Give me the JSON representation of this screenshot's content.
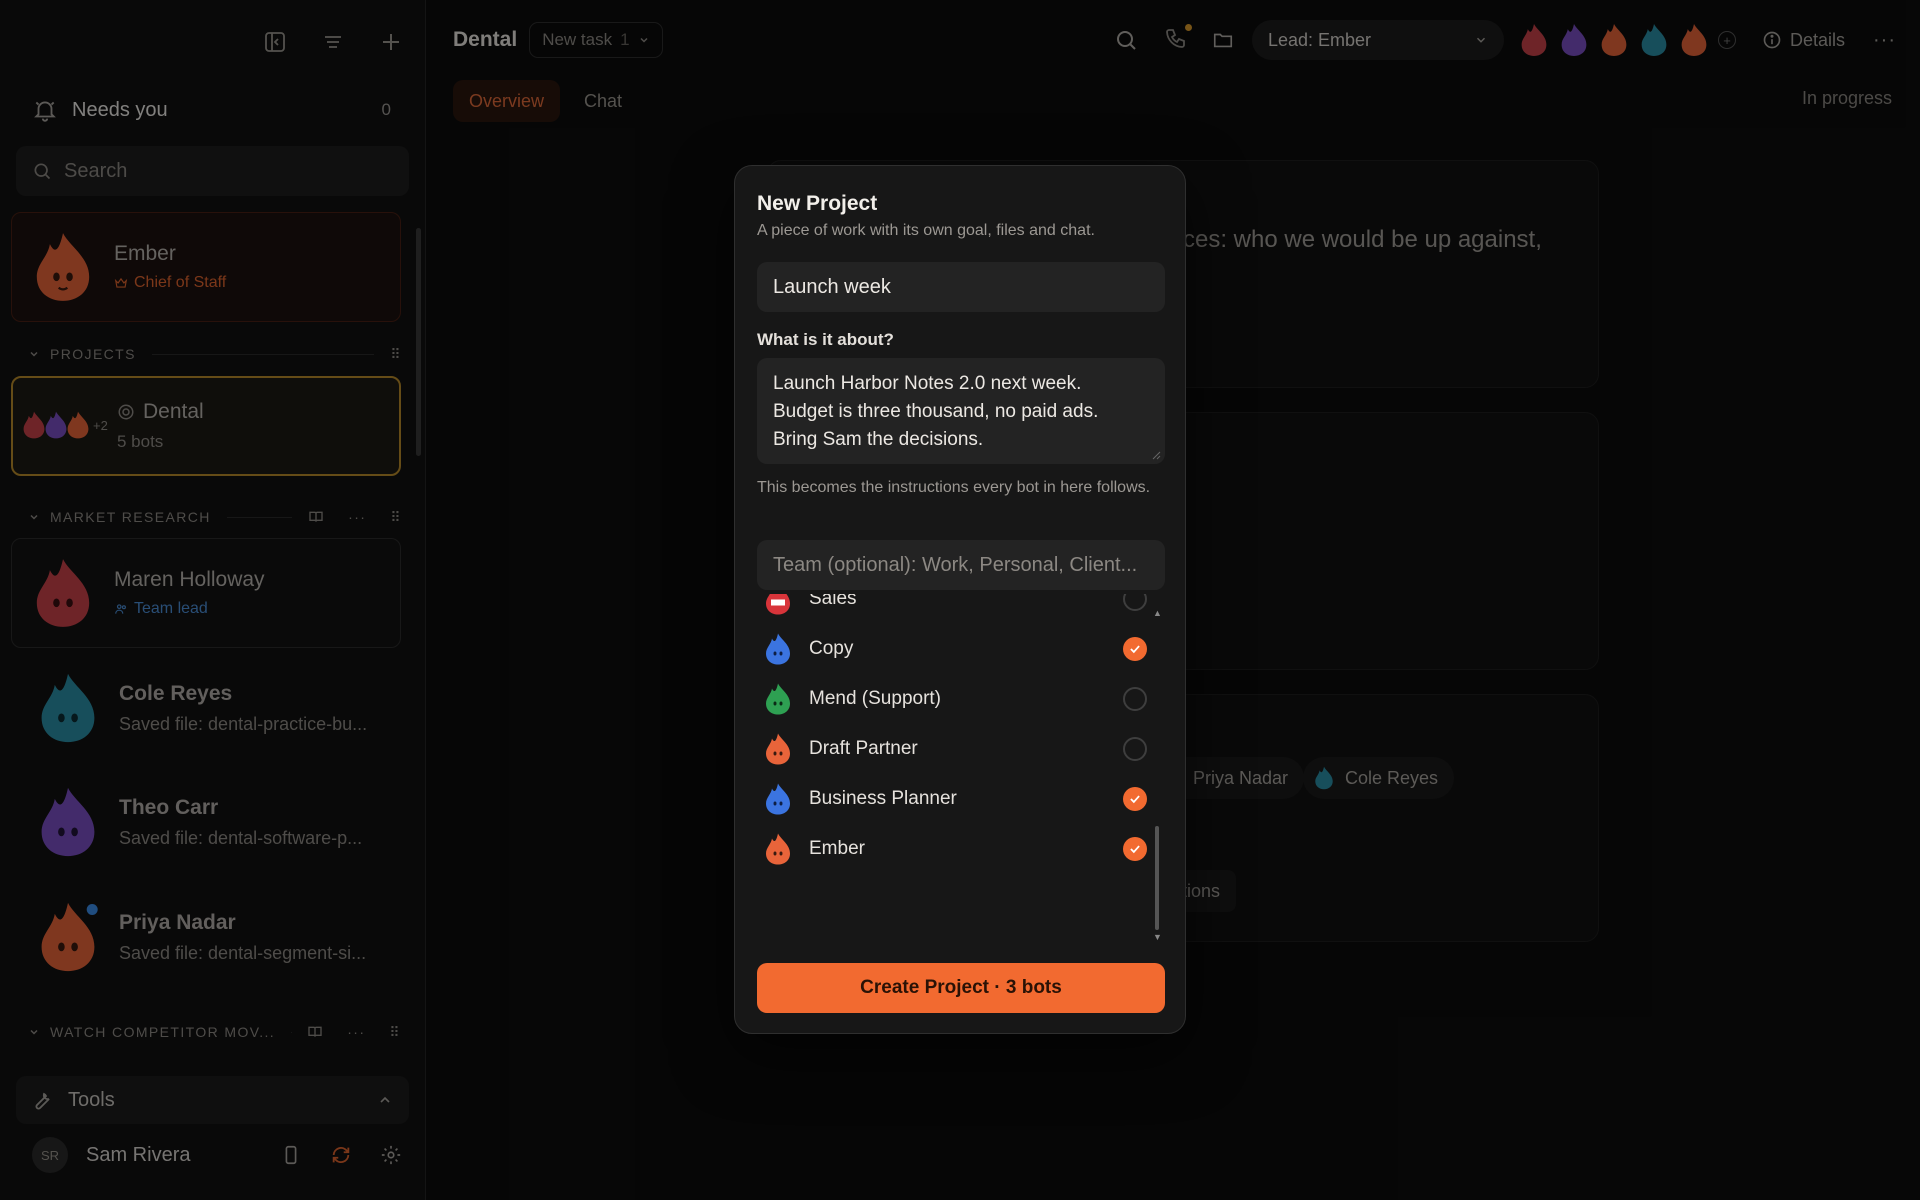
{
  "sidebar": {
    "needs_you_label": "Needs you",
    "needs_you_count": "0",
    "search_placeholder": "Search",
    "ember": {
      "name": "Ember",
      "role": "Chief of Staff"
    },
    "projects_header": "PROJECTS",
    "project": {
      "name": "Dental",
      "bots": "5 bots",
      "extra_count": "+2"
    },
    "market_header": "MARKET RESEARCH",
    "people": [
      {
        "name": "Maren Holloway",
        "sub": "Team lead"
      },
      {
        "name": "Cole Reyes",
        "sub": "Saved file: dental-practice-bu..."
      },
      {
        "name": "Theo Carr",
        "sub": "Saved file: dental-software-p..."
      },
      {
        "name": "Priya Nadar",
        "sub": "Saved file: dental-segment-si..."
      }
    ],
    "watch_header": "WATCH COMPETITOR MOV...",
    "tools_label": "Tools",
    "user": {
      "initials": "SR",
      "name": "Sam Rivera"
    }
  },
  "main": {
    "project_title": "Dental",
    "task_pill": {
      "label": "New task",
      "count": "1"
    },
    "lead_select": "Lead: Ember",
    "details_label": "Details",
    "tabs": [
      {
        "label": "Overview"
      },
      {
        "label": "Chat"
      }
    ],
    "status": "In progress",
    "bg_text_1": "ces: who we would be up against,",
    "chips": [
      {
        "name": "Priya Nadar"
      },
      {
        "name": "Cole Reyes"
      }
    ],
    "bg_text_2": "ctions"
  },
  "modal": {
    "title": "New Project",
    "subtitle": "A piece of work with its own goal, files and chat.",
    "name_value": "Launch week",
    "about_label": "What is it about?",
    "about_lines": [
      "Launch Harbor Notes 2.0 next week.",
      "Budget is three thousand, no paid ads.",
      "Bring Sam the decisions."
    ],
    "help_text": "This becomes the instructions every bot in here follows.",
    "team_placeholder": "Team (optional): Work, Personal, Client...",
    "bots": [
      {
        "name": "Sales",
        "checked": false
      },
      {
        "name": "Copy",
        "checked": true
      },
      {
        "name": "Mend (Support)",
        "checked": false
      },
      {
        "name": "Draft Partner",
        "checked": false
      },
      {
        "name": "Business Planner",
        "checked": true
      },
      {
        "name": "Ember",
        "checked": true
      }
    ],
    "create_label": "Create Project · 3 bots"
  },
  "colors": {
    "accent": "#f26a30",
    "ember_orange": "#e8643a",
    "maren_red": "#c9424a",
    "cole_teal": "#2b8fa6",
    "theo_purple": "#7a4fc4",
    "copy_blue": "#3b74e0",
    "mend_green": "#2ea052"
  }
}
